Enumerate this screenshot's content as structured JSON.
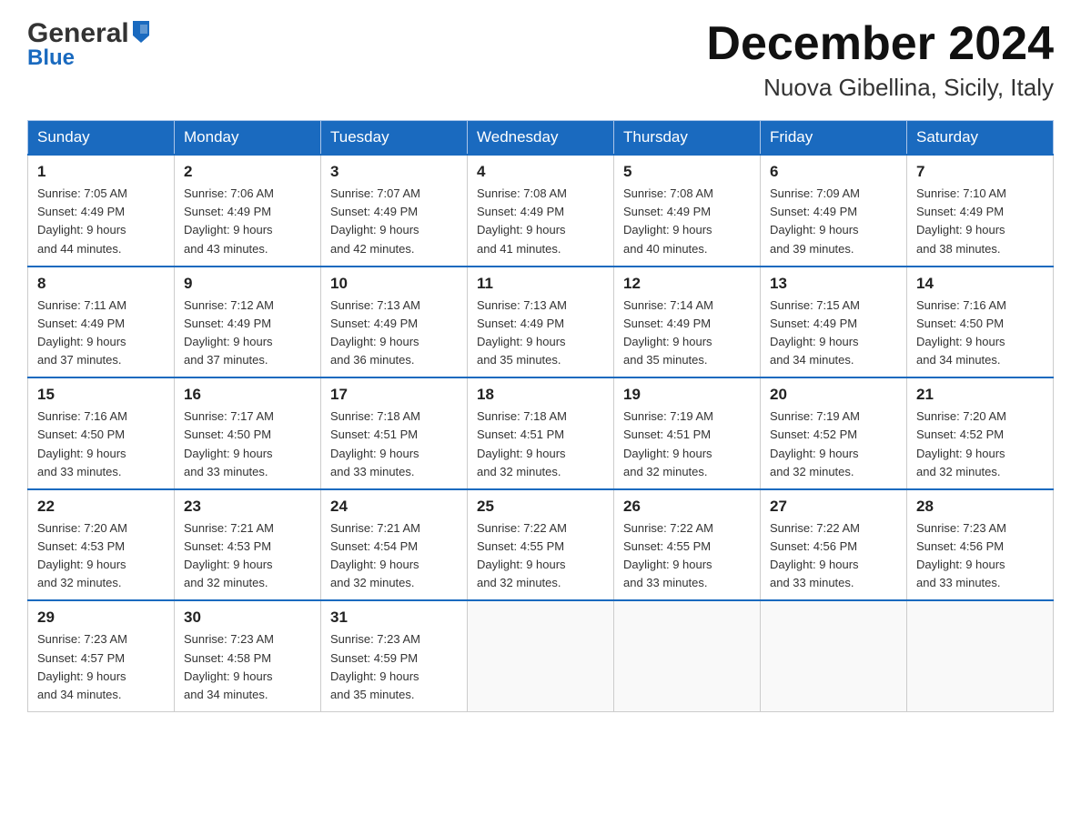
{
  "logo": {
    "line1_general": "General",
    "line1_blue": "Blue",
    "line2": "Blue"
  },
  "header": {
    "month_title": "December 2024",
    "location": "Nuova Gibellina, Sicily, Italy"
  },
  "weekdays": [
    "Sunday",
    "Monday",
    "Tuesday",
    "Wednesday",
    "Thursday",
    "Friday",
    "Saturday"
  ],
  "weeks": [
    [
      {
        "day": "1",
        "sunrise": "7:05 AM",
        "sunset": "4:49 PM",
        "daylight": "9 hours and 44 minutes."
      },
      {
        "day": "2",
        "sunrise": "7:06 AM",
        "sunset": "4:49 PM",
        "daylight": "9 hours and 43 minutes."
      },
      {
        "day": "3",
        "sunrise": "7:07 AM",
        "sunset": "4:49 PM",
        "daylight": "9 hours and 42 minutes."
      },
      {
        "day": "4",
        "sunrise": "7:08 AM",
        "sunset": "4:49 PM",
        "daylight": "9 hours and 41 minutes."
      },
      {
        "day": "5",
        "sunrise": "7:08 AM",
        "sunset": "4:49 PM",
        "daylight": "9 hours and 40 minutes."
      },
      {
        "day": "6",
        "sunrise": "7:09 AM",
        "sunset": "4:49 PM",
        "daylight": "9 hours and 39 minutes."
      },
      {
        "day": "7",
        "sunrise": "7:10 AM",
        "sunset": "4:49 PM",
        "daylight": "9 hours and 38 minutes."
      }
    ],
    [
      {
        "day": "8",
        "sunrise": "7:11 AM",
        "sunset": "4:49 PM",
        "daylight": "9 hours and 37 minutes."
      },
      {
        "day": "9",
        "sunrise": "7:12 AM",
        "sunset": "4:49 PM",
        "daylight": "9 hours and 37 minutes."
      },
      {
        "day": "10",
        "sunrise": "7:13 AM",
        "sunset": "4:49 PM",
        "daylight": "9 hours and 36 minutes."
      },
      {
        "day": "11",
        "sunrise": "7:13 AM",
        "sunset": "4:49 PM",
        "daylight": "9 hours and 35 minutes."
      },
      {
        "day": "12",
        "sunrise": "7:14 AM",
        "sunset": "4:49 PM",
        "daylight": "9 hours and 35 minutes."
      },
      {
        "day": "13",
        "sunrise": "7:15 AM",
        "sunset": "4:49 PM",
        "daylight": "9 hours and 34 minutes."
      },
      {
        "day": "14",
        "sunrise": "7:16 AM",
        "sunset": "4:50 PM",
        "daylight": "9 hours and 34 minutes."
      }
    ],
    [
      {
        "day": "15",
        "sunrise": "7:16 AM",
        "sunset": "4:50 PM",
        "daylight": "9 hours and 33 minutes."
      },
      {
        "day": "16",
        "sunrise": "7:17 AM",
        "sunset": "4:50 PM",
        "daylight": "9 hours and 33 minutes."
      },
      {
        "day": "17",
        "sunrise": "7:18 AM",
        "sunset": "4:51 PM",
        "daylight": "9 hours and 33 minutes."
      },
      {
        "day": "18",
        "sunrise": "7:18 AM",
        "sunset": "4:51 PM",
        "daylight": "9 hours and 32 minutes."
      },
      {
        "day": "19",
        "sunrise": "7:19 AM",
        "sunset": "4:51 PM",
        "daylight": "9 hours and 32 minutes."
      },
      {
        "day": "20",
        "sunrise": "7:19 AM",
        "sunset": "4:52 PM",
        "daylight": "9 hours and 32 minutes."
      },
      {
        "day": "21",
        "sunrise": "7:20 AM",
        "sunset": "4:52 PM",
        "daylight": "9 hours and 32 minutes."
      }
    ],
    [
      {
        "day": "22",
        "sunrise": "7:20 AM",
        "sunset": "4:53 PM",
        "daylight": "9 hours and 32 minutes."
      },
      {
        "day": "23",
        "sunrise": "7:21 AM",
        "sunset": "4:53 PM",
        "daylight": "9 hours and 32 minutes."
      },
      {
        "day": "24",
        "sunrise": "7:21 AM",
        "sunset": "4:54 PM",
        "daylight": "9 hours and 32 minutes."
      },
      {
        "day": "25",
        "sunrise": "7:22 AM",
        "sunset": "4:55 PM",
        "daylight": "9 hours and 32 minutes."
      },
      {
        "day": "26",
        "sunrise": "7:22 AM",
        "sunset": "4:55 PM",
        "daylight": "9 hours and 33 minutes."
      },
      {
        "day": "27",
        "sunrise": "7:22 AM",
        "sunset": "4:56 PM",
        "daylight": "9 hours and 33 minutes."
      },
      {
        "day": "28",
        "sunrise": "7:23 AM",
        "sunset": "4:56 PM",
        "daylight": "9 hours and 33 minutes."
      }
    ],
    [
      {
        "day": "29",
        "sunrise": "7:23 AM",
        "sunset": "4:57 PM",
        "daylight": "9 hours and 34 minutes."
      },
      {
        "day": "30",
        "sunrise": "7:23 AM",
        "sunset": "4:58 PM",
        "daylight": "9 hours and 34 minutes."
      },
      {
        "day": "31",
        "sunrise": "7:23 AM",
        "sunset": "4:59 PM",
        "daylight": "9 hours and 35 minutes."
      },
      null,
      null,
      null,
      null
    ]
  ]
}
